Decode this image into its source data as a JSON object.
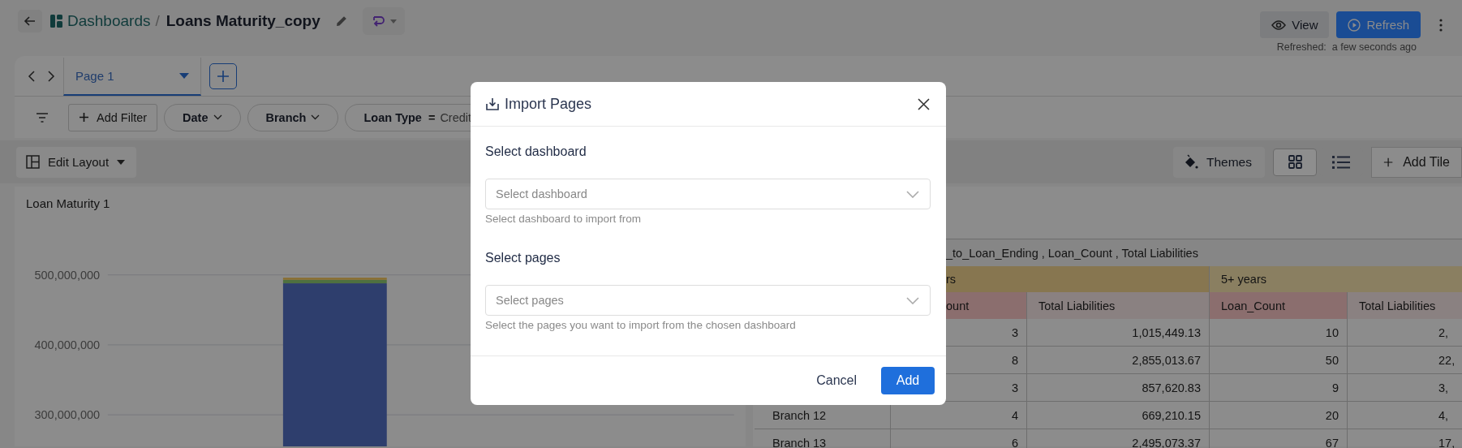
{
  "breadcrumb": {
    "root": "Dashboards",
    "separator": "/",
    "title": "Loans Maturity_copy"
  },
  "actions": [
    {
      "label": "View",
      "kind": "secondary"
    },
    {
      "label": "Refresh",
      "kind": "primary"
    }
  ],
  "refreshed": "Refreshed:  a few seconds ago",
  "pages": [
    {
      "label": "Page 1",
      "selected": true
    }
  ],
  "add_filter": "Add Filter",
  "filters": [
    {
      "kind": "dropdown",
      "label": "Date"
    },
    {
      "kind": "dropdown",
      "label": "Branch"
    },
    {
      "kind": "condition",
      "label": "Loan Type",
      "operator": "=",
      "value": "Credit"
    }
  ],
  "edit_layout": "Edit Layout",
  "toolbar": {
    "themes": "Themes",
    "view_modes": [
      {
        "kind": "grid",
        "selected": true
      },
      {
        "kind": "list",
        "selected": false
      }
    ],
    "add_tile": "Add Tile"
  },
  "chart_tile": {
    "title": "Loan Maturity 1",
    "chart_data": {
      "type": "bar",
      "stacked": true,
      "ylim": [
        0,
        500000000
      ],
      "yticks": [
        {
          "value": 300000000,
          "label": "300,000,000"
        },
        {
          "value": 400000000,
          "label": "400,000,000"
        },
        {
          "value": 500000000,
          "label": "500,000,000"
        }
      ],
      "series": [
        {
          "color": "#2e3e6d",
          "values": [
            488000000
          ]
        },
        {
          "color": "#4f7040",
          "values": [
            5000000
          ]
        },
        {
          "color": "#8a6e30",
          "values": [
            3000000
          ]
        }
      ]
    }
  },
  "table_tile": {
    "caption": "_to_Loan_Ending , Loan_Count , Total Liabilities",
    "groups": [
      {
        "label": "rs",
        "color": "#877650"
      },
      {
        "label": "5+ years",
        "color": "#8a7f61"
      }
    ],
    "columns": [
      {
        "label": "ount",
        "color": "#8b6e6e"
      },
      {
        "label": "Total Liabilities",
        "color": "#8a8181"
      },
      {
        "label": "Loan_Count",
        "color": "#8b6e6e"
      },
      {
        "label": "Total Liabilities",
        "color": "#8a8181"
      }
    ],
    "rows": [
      {
        "cells": [
          "3",
          "1,015,449.13",
          "10",
          "2,"
        ]
      },
      {
        "cells": [
          "8",
          "2,855,013.67",
          "50",
          "22,"
        ]
      },
      {
        "cells": [
          "3",
          "857,620.83",
          "9",
          "3,"
        ]
      },
      {
        "branch": "Branch 12",
        "cells": [
          "4",
          "669,210.15",
          "20",
          "4,"
        ]
      },
      {
        "branch": "Branch 13",
        "cells": [
          "6",
          "2,495,073.37",
          "67",
          "17,"
        ]
      }
    ]
  },
  "modal": {
    "title": "Import Pages",
    "fields": [
      {
        "label": "Select dashboard",
        "placeholder": "Select dashboard",
        "help": "Select dashboard to import from"
      },
      {
        "label": "Select pages",
        "placeholder": "Select pages",
        "help": "Select the pages you want to import from the chosen dashboard"
      }
    ],
    "buttons": [
      {
        "label": "Cancel",
        "kind": "text"
      },
      {
        "label": "Add",
        "kind": "primary"
      }
    ]
  }
}
